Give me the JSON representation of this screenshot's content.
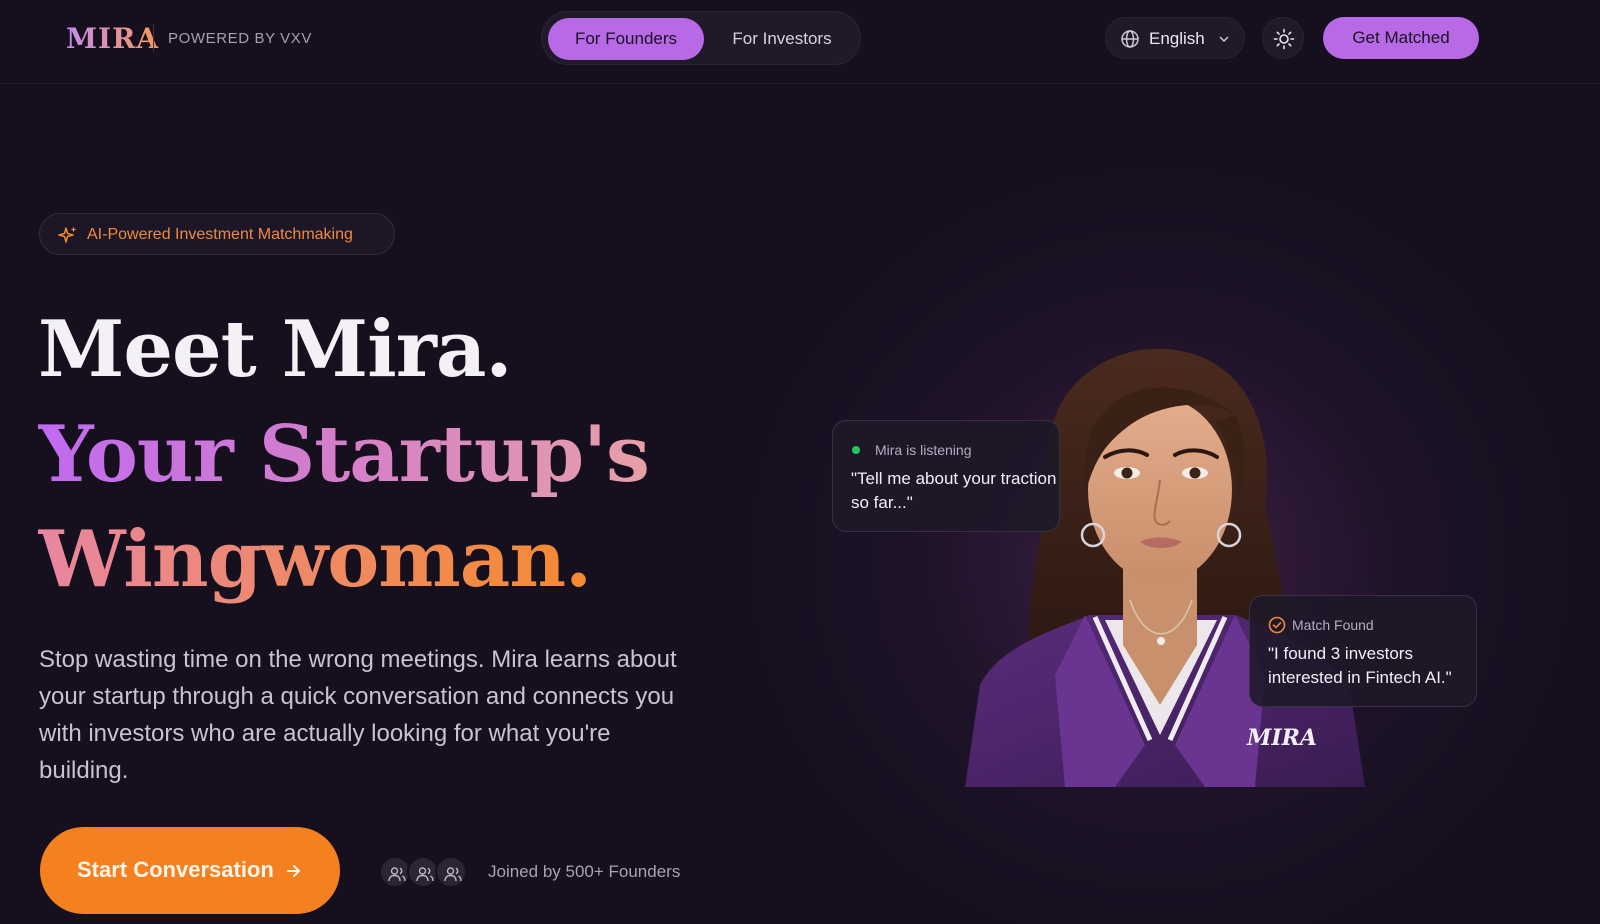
{
  "brand": {
    "logo_text": "MIRA",
    "powered_by": "POWERED BY VXV"
  },
  "nav": {
    "segments": [
      {
        "label": "For Founders",
        "selected": true
      },
      {
        "label": "For Investors",
        "selected": false
      }
    ],
    "language": {
      "label": "English",
      "icon": "globe-icon"
    },
    "theme_toggle_icon": "sun-icon",
    "cta_label": "Get Matched"
  },
  "hero": {
    "badge": {
      "icon": "sparkles-icon",
      "text": "AI-Powered Investment Matchmaking"
    },
    "headline": {
      "line1": "Meet Mira.",
      "line2": "Your Startup's",
      "line3": "Wingwoman."
    },
    "description": "Stop wasting time on the wrong meetings. Mira learns about your startup through a quick conversation and connects you with investors who are actually looking for what you're building.",
    "cta": {
      "label": "Start Conversation",
      "icon": "arrow-right-icon"
    },
    "social_proof": {
      "avatar_icons": [
        "users-icon",
        "users-icon",
        "users-icon"
      ],
      "text": "Joined by 500+ Founders"
    }
  },
  "visual": {
    "portrait_badge": "MIRA",
    "listening_card": {
      "status": "Mira is listening",
      "quote": "\"Tell me about your traction so far...\""
    },
    "match_card": {
      "icon": "check-circle-icon",
      "status": "Match Found",
      "quote": "\"I found 3 investors interested in Fintech AI.\""
    }
  },
  "colors": {
    "background": "#150f1e",
    "accent_purple": "#b86ae6",
    "accent_orange": "#f5801f",
    "status_green": "#22c55e"
  }
}
